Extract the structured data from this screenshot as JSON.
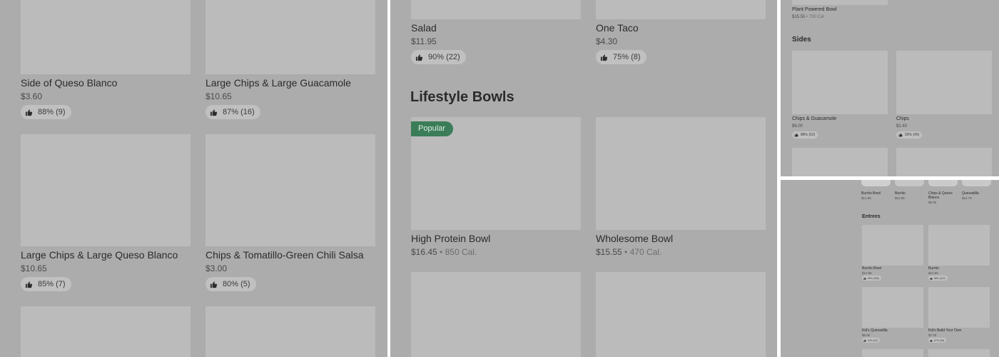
{
  "colors": {
    "overlay_bg": "#acacac",
    "placeholder": "#bbbbbb",
    "popular_badge": "#3a7d58",
    "separator": "#ffffff"
  },
  "panel1": {
    "items": [
      {
        "title": "Side of Queso Blanco",
        "price": "$3.60",
        "rating": "88% (9)"
      },
      {
        "title": "Large Chips & Large Guacamole",
        "price": "$10.65",
        "rating": "87% (16)"
      },
      {
        "title": "Large Chips & Large Queso Blanco",
        "price": "$10.65",
        "rating": "85% (7)"
      },
      {
        "title": "Chips & Tomatillo-Green Chili Salsa",
        "price": "$3.00",
        "rating": "80% (5)"
      }
    ]
  },
  "panel2": {
    "top_items": [
      {
        "title": "Salad",
        "price": "$11.95",
        "rating": "90% (22)"
      },
      {
        "title": "One Taco",
        "price": "$4.30",
        "rating": "75% (8)"
      }
    ],
    "section_title": "Lifestyle Bowls",
    "popular_label": "Popular",
    "items": [
      {
        "title": "High Protein Bowl",
        "price": "$16.45",
        "separator": "•",
        "calories": "850 Cal."
      },
      {
        "title": "Wholesome Bowl",
        "price": "$15.55",
        "separator": "•",
        "calories": "470 Cal."
      }
    ]
  },
  "panel3": {
    "top_item": {
      "title": "Plant Powered Bowl",
      "price": "$15.55",
      "separator": "•",
      "calories": "730 Cal."
    },
    "section_title": "Sides",
    "items": [
      {
        "title": "Chips & Guacamole",
        "price": "$6.00",
        "rating": "88% (52)"
      },
      {
        "title": "Chips",
        "price": "$2.40",
        "rating": "93% (45)"
      }
    ]
  },
  "panel4": {
    "top_items": [
      {
        "title": "Burrito Bowl",
        "price": "$12.95"
      },
      {
        "title": "Burrito",
        "price": "$12.95"
      },
      {
        "title": "Chips & Queso Blanco",
        "price": "$6.00"
      },
      {
        "title": "Quesadilla",
        "price": "$12.70"
      }
    ],
    "section_title": "Entrees",
    "items": [
      {
        "title": "Burrito Bowl",
        "price": "$12.95",
        "rating": "89% (353)"
      },
      {
        "title": "Burrito",
        "price": "$12.95",
        "rating": "88% (327)"
      },
      {
        "title": "Kid's Quesadilla",
        "price": "$5.60",
        "rating": "92% (22)"
      },
      {
        "title": "Kid's Build Your Own",
        "price": "$7.00",
        "rating": "87% (39)"
      }
    ]
  }
}
